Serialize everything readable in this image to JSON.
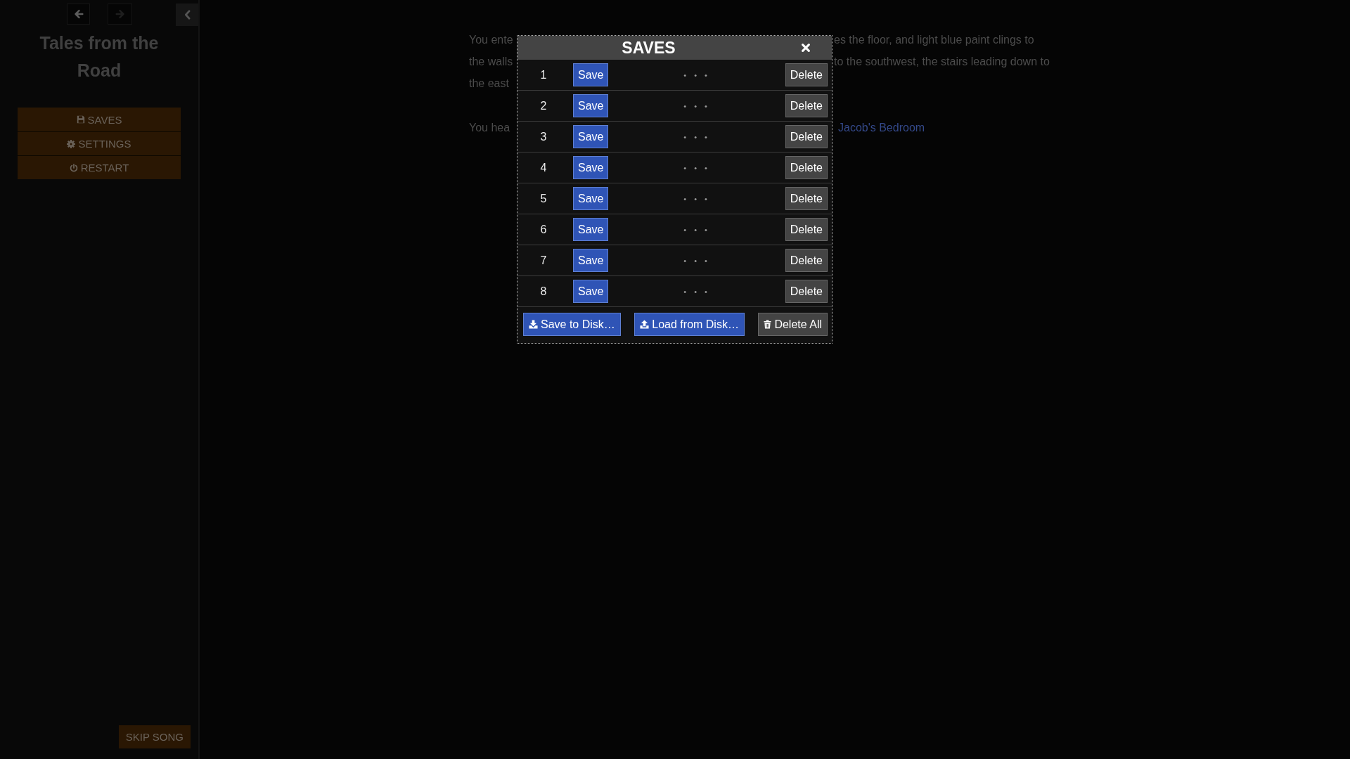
{
  "sidebar": {
    "history_buttons": [
      {
        "kind": "back",
        "disabled": false
      },
      {
        "kind": "forward",
        "disabled": true
      }
    ],
    "story_title": "Tales from the Road",
    "menu": [
      {
        "kind": "saves",
        "label": "SAVES"
      },
      {
        "kind": "settings",
        "label": "SETTINGS"
      },
      {
        "kind": "restart",
        "label": "RESTART"
      }
    ],
    "skip_song_button": "SKIP SONG"
  },
  "passage": {
    "paragraphs": [
      {
        "lines": [
          {
            "left": "You ente",
            "right": "es the floor, and light blue paint clings to"
          },
          {
            "left": "the walls",
            "right": "to the southwest, the stairs leading down to"
          },
          {
            "left": "the east"
          }
        ]
      },
      {
        "lines": [
          {
            "left": "You hea",
            "link": "Jacob's Bedroom"
          }
        ]
      }
    ]
  },
  "dialog": {
    "title": "SAVES",
    "slots": [
      {
        "number": "1",
        "save_label": "Save",
        "description": "• • •",
        "delete_label": "Delete"
      },
      {
        "number": "2",
        "save_label": "Save",
        "description": "• • •",
        "delete_label": "Delete"
      },
      {
        "number": "3",
        "save_label": "Save",
        "description": "• • •",
        "delete_label": "Delete"
      },
      {
        "number": "4",
        "save_label": "Save",
        "description": "• • •",
        "delete_label": "Delete"
      },
      {
        "number": "5",
        "save_label": "Save",
        "description": "• • •",
        "delete_label": "Delete"
      },
      {
        "number": "6",
        "save_label": "Save",
        "description": "• • •",
        "delete_label": "Delete"
      },
      {
        "number": "7",
        "save_label": "Save",
        "description": "• • •",
        "delete_label": "Delete"
      },
      {
        "number": "8",
        "save_label": "Save",
        "description": "• • •",
        "delete_label": "Delete"
      }
    ],
    "footer_buttons": [
      {
        "kind": "export",
        "label": "Save to Disk…"
      },
      {
        "kind": "import",
        "label": "Load from Disk…"
      },
      {
        "kind": "clear",
        "label": "Delete All"
      }
    ]
  }
}
